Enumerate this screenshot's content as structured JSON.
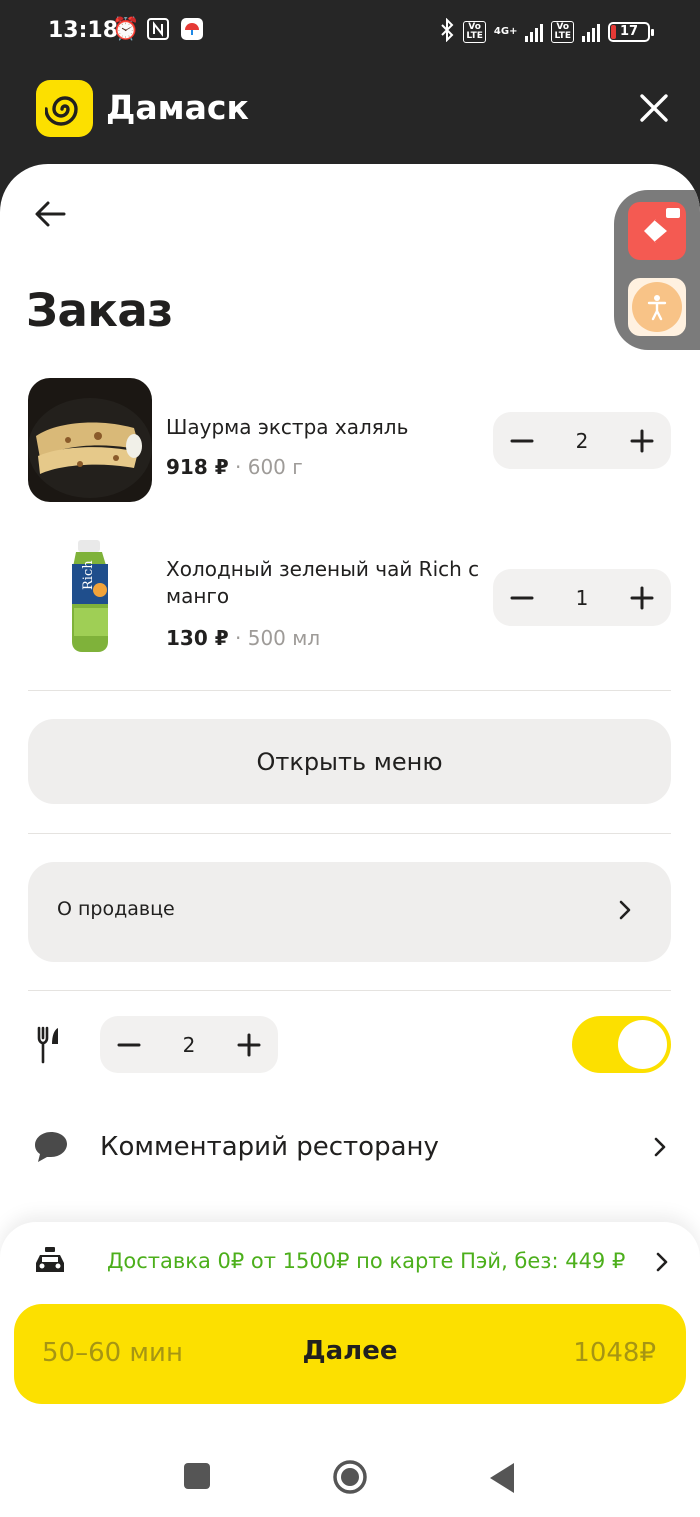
{
  "status_bar": {
    "time": "13:18",
    "network": "4G+",
    "volte": "Vo LTE",
    "battery": "17"
  },
  "app": {
    "title": "Дамаск"
  },
  "page": {
    "title": "Заказ"
  },
  "items": [
    {
      "name": "Шаурма экстра халяль",
      "price": "918 ₽",
      "weight": "· 600 г",
      "qty": "2"
    },
    {
      "name": "Холодный зеленый чай Rich с манго",
      "price": "130 ₽",
      "weight": "· 500 мл",
      "qty": "1"
    }
  ],
  "menu_button": "Открыть меню",
  "seller_label": "О продавце",
  "cutlery": {
    "qty": "2",
    "enabled": true
  },
  "comment_label": "Комментарий ресторану",
  "delivery_text": "Доставка 0₽ от 1500₽ по карте Пэй, без: 449 ₽",
  "checkout": {
    "time": "50–60 мин",
    "label": "Далее",
    "total": "1048₽"
  },
  "colors": {
    "accent": "#fce000",
    "delivery_green": "#4caf1b",
    "header_bg": "#262626"
  }
}
